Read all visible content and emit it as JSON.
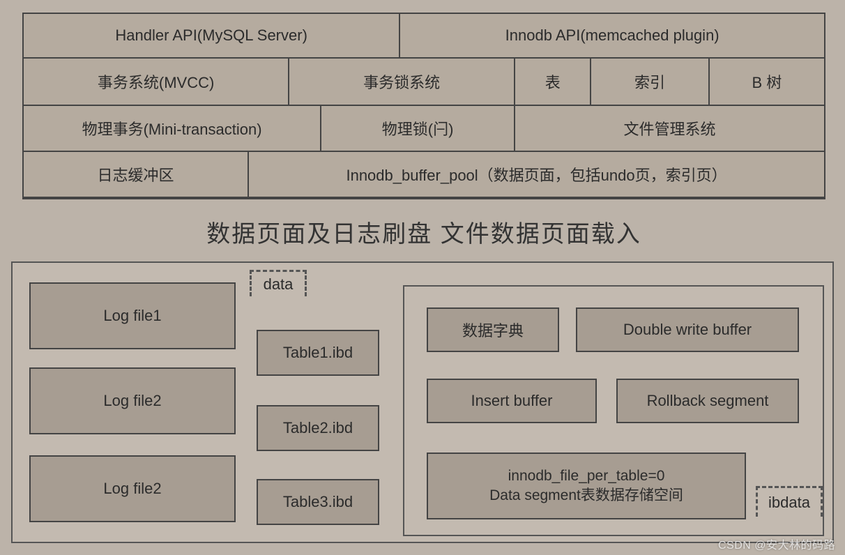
{
  "arch": {
    "api_handler": "Handler API(MySQL Server)",
    "api_innodb": "Innodb API(memcached plugin)",
    "mvcc": "事务系统(MVCC)",
    "locksys": "事务锁系统",
    "tbl": "表",
    "idx": "索引",
    "btree": "B 树",
    "mini_txn": "物理事务(Mini-transaction)",
    "latch": "物理锁(闩)",
    "filemgr": "文件管理系统",
    "logbuf": "日志缓冲区",
    "bufpool": "Innodb_buffer_pool（数据页面，包括undo页，索引页）"
  },
  "caption": "数据页面及日志刷盘  文件数据页面载入",
  "files": {
    "log1": "Log file1",
    "log2": "Log file2",
    "log3": "Log file2",
    "data_label": "data",
    "t1": "Table1.ibd",
    "t2": "Table2.ibd",
    "t3": "Table3.ibd",
    "dict": "数据字典",
    "dwb": "Double write buffer",
    "ibuf": "Insert buffer",
    "rbseg": "Rollback segment",
    "dataseg_a": "innodb_file_per_table=0",
    "dataseg_b": "Data segment表数据存储空间",
    "ibdata_label": "ibdata"
  },
  "watermark": "CSDN @安大林的码路"
}
